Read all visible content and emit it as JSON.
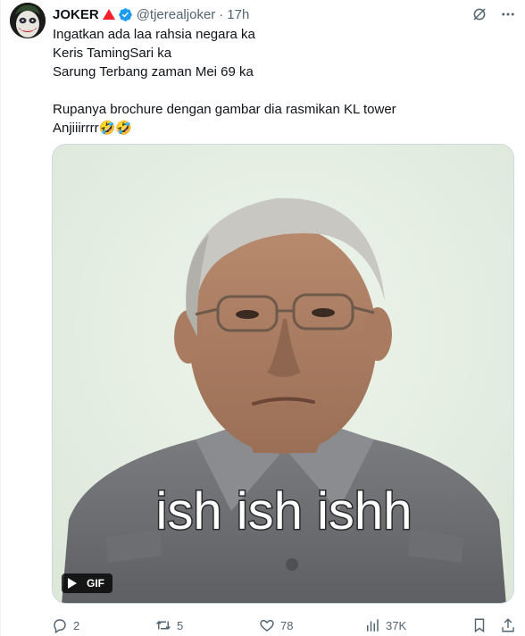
{
  "author": {
    "display_name": "JOKER",
    "name_emoji": "red-triangle-icon",
    "verified_icon": "verified-badge-icon",
    "handle": "@tjerealjoker",
    "separator": "·",
    "time": "17h"
  },
  "header_actions": [
    "grok-icon",
    "more-icon"
  ],
  "tweet": {
    "lines": [
      "Ingatkan ada laa rahsia negara ka",
      "Keris TamingSari ka",
      "Sarung Terbang zaman Mei 69 ka",
      "Rupanya brochure dengan gambar dia rasmikan KL tower",
      "Anjiiirrrr🤣🤣"
    ]
  },
  "media": {
    "type": "gif",
    "caption": "ish ish ishh",
    "gif_badge": "GIF"
  },
  "stats": {
    "replies": "2",
    "retweets": "5",
    "likes": "78",
    "views": "37K"
  },
  "colors": {
    "text": "#0f1419",
    "secondary": "#536471",
    "verified": "#1d9bf0",
    "name_emoji": "#f4212e",
    "media_bg": "#e6efe5"
  }
}
